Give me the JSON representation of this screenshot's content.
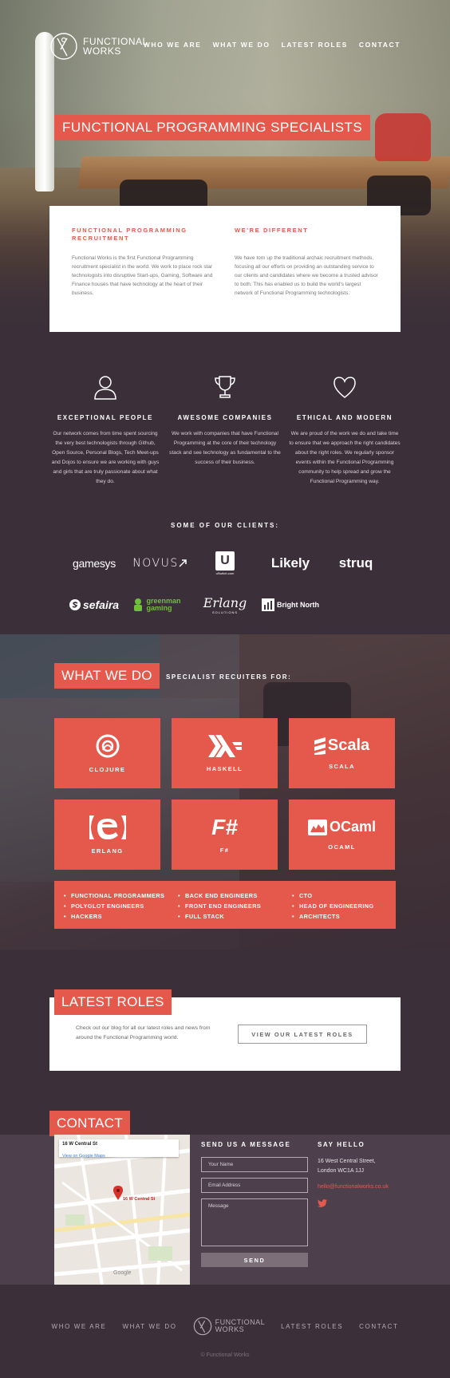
{
  "header": {
    "logo_line1": "FUNCTIONAL",
    "logo_line2": "WORKS",
    "nav": [
      "WHO WE ARE",
      "WHAT WE DO",
      "LATEST ROLES",
      "CONTACT"
    ]
  },
  "hero": {
    "title": "FUNCTIONAL PROGRAMMING SPECIALISTS"
  },
  "intro": {
    "left_heading": "FUNCTIONAL PROGRAMMING RECRUITMENT",
    "left_text": "Functional Works is the first Functional Programming recruitment specialist in the world. We work to place rock star technologists into disruptive Start-ups, Gaming, Software and Finance houses that have technology at the heart of their business.",
    "right_heading": "WE'RE DIFFERENT",
    "right_text": "We have torn up the traditional archaic recruitment methods, focusing all our efforts on providing an outstanding service to our clients and candidates where we become a trusted advisor to both. This has enabled us to build the world's largest network of Functional Programming technologists."
  },
  "features": [
    {
      "icon": "person-icon",
      "title": "EXCEPTIONAL PEOPLE",
      "text": "Our network comes from time spent sourcing the very best technologists through Github, Open Source, Personal Blogs, Tech Meet-ups and Dojos to ensure we are working with guys and girls that are truly passionate about what they do."
    },
    {
      "icon": "trophy-icon",
      "title": "AWESOME COMPANIES",
      "text": "We work with companies that have Functional Programming at the core of their technology stack and see technology as fundamental to the success of their business."
    },
    {
      "icon": "heart-icon",
      "title": "ETHICAL AND MODERN",
      "text": "We are proud of the work we do and take time to ensure that we approach the right candidates about the right roles. We regularly sponsor events within the Functional Programming community to help spread and grow the Functional Programming way."
    }
  ],
  "clients": {
    "title": "SOME OF OUR CLIENTS:",
    "logos": [
      "gamesys",
      "NOVUS",
      "U",
      "Likely",
      "struq",
      "sefaira",
      "greenman gaming",
      "Erlang",
      "Bright North"
    ],
    "logo_sub": {
      "u": "uSwitch.com",
      "erlang": "SOLUTIONS"
    }
  },
  "what_we_do": {
    "title": "WHAT WE DO",
    "subtitle": "SPECIALIST RECUITERS FOR:",
    "languages": [
      {
        "name": "CLOJURE",
        "icon": "clojure-icon"
      },
      {
        "name": "HASKELL",
        "icon": "haskell-icon"
      },
      {
        "name": "SCALA",
        "icon": "scala-icon",
        "mark": "Scala"
      },
      {
        "name": "ERLANG",
        "icon": "erlang-icon"
      },
      {
        "name": "F#",
        "icon": "fsharp-icon",
        "mark": "F#"
      },
      {
        "name": "OCAML",
        "icon": "ocaml-icon",
        "mark": "OCaml"
      }
    ],
    "roles_col1": [
      "FUNCTIONAL PROGRAMMERS",
      "POLYGLOT ENGINEERS",
      "HACKERS"
    ],
    "roles_col2": [
      "BACK END ENGINEERS",
      "FRONT END ENGINEERS",
      "FULL STACK"
    ],
    "roles_col3": [
      "CTO",
      "HEAD OF ENGINEERING",
      "ARCHITECTS"
    ]
  },
  "latest_roles": {
    "title": "LATEST ROLES",
    "text": "Check out our blog for all our latest roles and news from around the Functional Programming world.",
    "button": "VIEW OUR LATEST ROLES"
  },
  "contact": {
    "title": "CONTACT",
    "map": {
      "place": "16 W Central St",
      "link": "View on Google Maps",
      "pin_label": "16 W Central St",
      "brand": "Google"
    },
    "form": {
      "heading": "SEND US A MESSAGE",
      "name_placeholder": "Your Name",
      "email_placeholder": "Email Address",
      "message_placeholder": "Message",
      "send": "SEND"
    },
    "say_hello": {
      "heading": "SAY HELLO",
      "address_line1": "16 West Central Street,",
      "address_line2": "London WC1A 1JJ",
      "email": "hello@functionalworks.co.uk"
    }
  },
  "footer": {
    "nav_left": [
      "WHO WE ARE",
      "WHAT WE DO"
    ],
    "nav_right": [
      "LATEST ROLES",
      "CONTACT"
    ],
    "logo_line1": "FUNCTIONAL",
    "logo_line2": "WORKS",
    "copyright": "© Functional Works"
  },
  "colors": {
    "accent": "#e4594b",
    "background": "#3b2f39",
    "contact_band": "#4d404c"
  }
}
